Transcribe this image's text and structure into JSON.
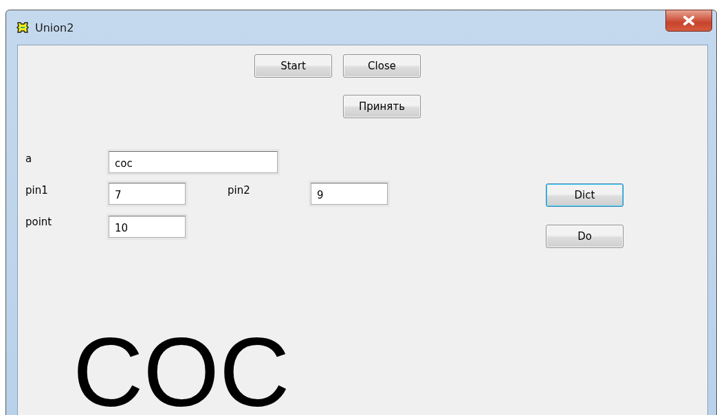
{
  "window": {
    "title": "Union2"
  },
  "buttons": [
    {
      "label": "Start",
      "focused": false
    },
    {
      "label": "Close",
      "focused": false
    },
    {
      "label": "Принять",
      "focused": false
    },
    {
      "label": "Dict",
      "focused": true
    },
    {
      "label": "Do",
      "focused": false
    }
  ],
  "fields": [
    {
      "label": "a",
      "value": "coc"
    },
    {
      "label": "pin1",
      "value": "7"
    },
    {
      "label": "pin2",
      "value": "9"
    },
    {
      "label": "point",
      "value": "10"
    }
  ],
  "output_text": "COC"
}
